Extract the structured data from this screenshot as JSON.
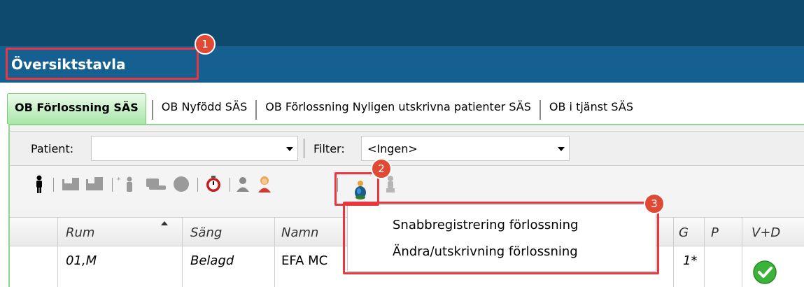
{
  "header": {
    "title": "Översiktstavla"
  },
  "tabs": [
    {
      "label": "OB Förlossning SÄS",
      "active": true
    },
    {
      "label": "OB Nyfödd SÄS",
      "active": false
    },
    {
      "label": "OB Förlossning Nyligen utskrivna patienter SÄS",
      "active": false
    },
    {
      "label": "OB i tjänst SÄS",
      "active": false
    }
  ],
  "filters": {
    "patient_label": "Patient:",
    "patient_value": "",
    "filter_label": "Filter:",
    "filter_value": "<Ingen>"
  },
  "toolbar": {
    "icons": [
      "person-icon",
      "bed-icon",
      "bed-icon",
      "move-person-icon",
      "transfer-icon",
      "circle-icon",
      "timer-icon",
      "user-icon",
      "female-user-icon",
      "pregnant-icon",
      "person-gray-icon"
    ]
  },
  "context_menu": {
    "items": [
      "Snabbregistrering förlossning",
      "Ändra/utskrivning förlossning"
    ]
  },
  "grid": {
    "columns": [
      "Rum",
      "Säng",
      "Namn",
      "G",
      "P",
      "V+D"
    ],
    "rows": [
      {
        "rum": "01,M",
        "sang": "Belagd",
        "namn": "EFA MC",
        "g": "1*",
        "p": "",
        "vd": "check"
      }
    ]
  },
  "callouts": [
    "1",
    "2",
    "3"
  ],
  "colors": {
    "topbar": "#0e4a6e",
    "titlebar": "#155f91",
    "callout": "#e8373e",
    "active_tab": "#a8e6a8",
    "check": "#3bb33b"
  }
}
